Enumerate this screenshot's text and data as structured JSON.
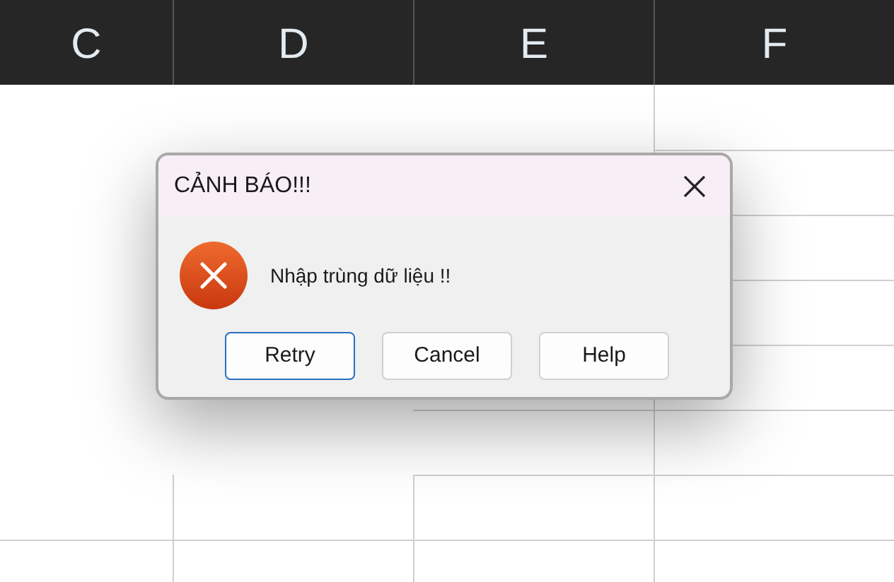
{
  "sheet": {
    "columns": [
      "C",
      "D",
      "E",
      "F"
    ]
  },
  "dialog": {
    "title": "CẢNH BÁO!!!",
    "kind": "error",
    "message": "Nhập trùng dữ liệu !!",
    "buttons": [
      {
        "label": "Retry",
        "default": true
      },
      {
        "label": "Cancel",
        "default": false
      },
      {
        "label": "Help",
        "default": false
      }
    ]
  }
}
